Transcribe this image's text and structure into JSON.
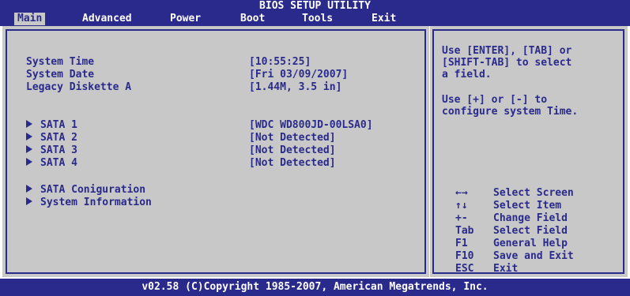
{
  "title": "BIOS SETUP UTILITY",
  "menu": [
    {
      "label": "Main",
      "active": true
    },
    {
      "label": "Advanced",
      "active": false
    },
    {
      "label": "Power",
      "active": false
    },
    {
      "label": "Boot",
      "active": false
    },
    {
      "label": "Tools",
      "active": false
    },
    {
      "label": "Exit",
      "active": false
    }
  ],
  "main": {
    "settings": [
      {
        "label": "System Time",
        "value": "[10:55:25]"
      },
      {
        "label": "System Date",
        "value": "[Fri 03/09/2007]"
      },
      {
        "label": "Legacy Diskette A",
        "value": "[1.44M, 3.5 in]"
      }
    ],
    "sata": [
      {
        "label": "SATA 1",
        "value": "[WDC WD800JD-00LSA0]"
      },
      {
        "label": "SATA 2",
        "value": "[Not Detected]"
      },
      {
        "label": "SATA 3",
        "value": "[Not Detected]"
      },
      {
        "label": "SATA 4",
        "value": "[Not Detected]"
      }
    ],
    "submenus": [
      {
        "label": "SATA Coniguration"
      },
      {
        "label": "System Information"
      }
    ]
  },
  "help": {
    "text1": "Use [ENTER], [TAB] or\n[SHIFT-TAB] to select\na field.",
    "text2": "Use [+] or [-] to\nconfigure system Time.",
    "keys": [
      {
        "key": "←→",
        "desc": "Select Screen"
      },
      {
        "key": "↑↓",
        "desc": "Select Item"
      },
      {
        "key": "+-",
        "desc": "Change Field"
      },
      {
        "key": "Tab",
        "desc": "Select Field"
      },
      {
        "key": "F1",
        "desc": "General Help"
      },
      {
        "key": "F10",
        "desc": "Save and Exit"
      },
      {
        "key": "ESC",
        "desc": "Exit"
      }
    ]
  },
  "footer": "v02.58 (C)Copyright 1985-2007, American Megatrends, Inc.",
  "colors": {
    "accent": "#2a2a8c",
    "panel": "#c8c8c8",
    "text_on_accent": "#ffffff"
  }
}
